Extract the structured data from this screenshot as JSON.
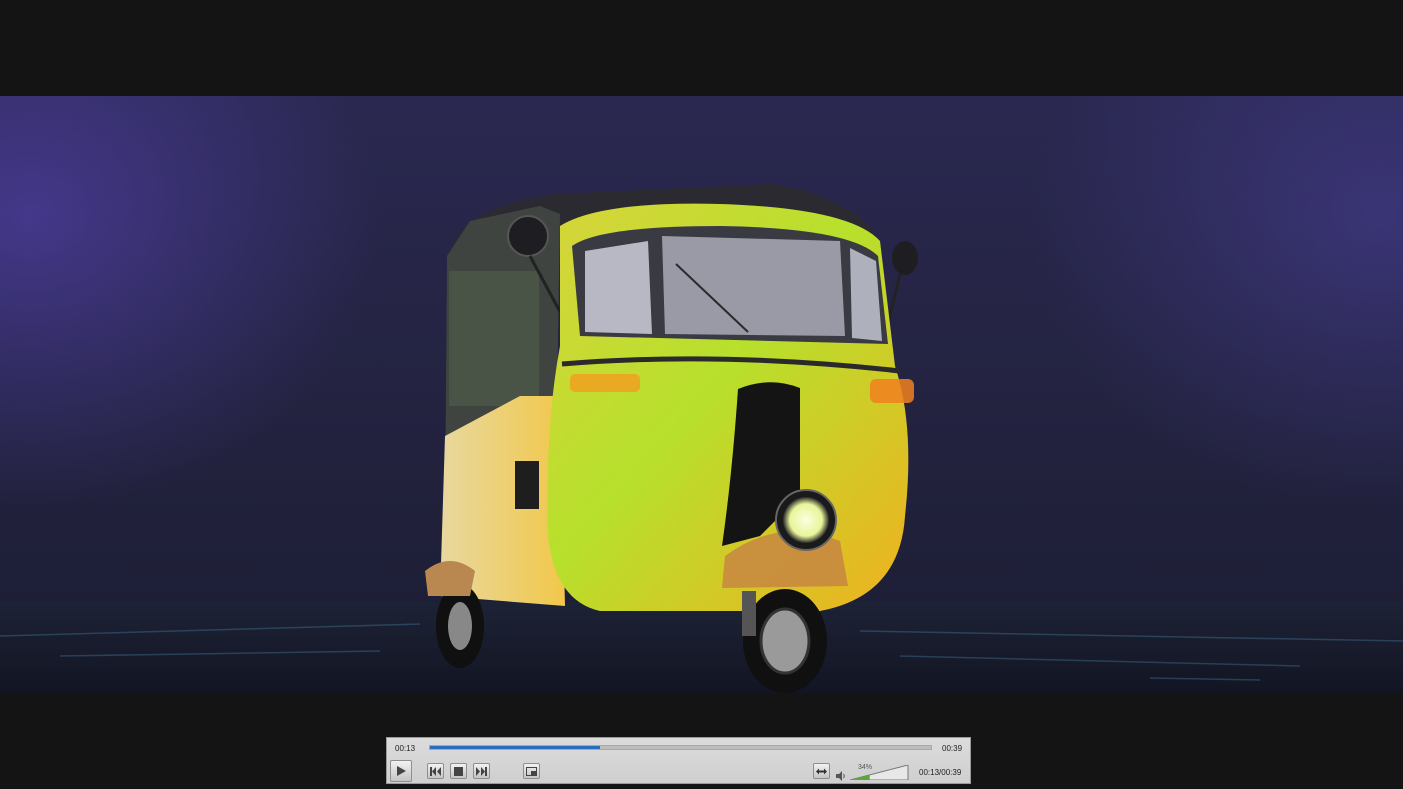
{
  "player": {
    "elapsed": "00:13",
    "duration": "00:39",
    "progress_fraction": 0.34,
    "volume_label": "34%",
    "volume_fraction": 0.34,
    "time_readout": "00:13/00:39"
  },
  "controls": {
    "play": "play-icon",
    "previous": "skip-back-icon",
    "stop": "stop-icon",
    "next": "skip-forward-icon",
    "snapshot": "picture-in-picture-icon",
    "fit": "fit-width-icon",
    "volume": "speaker-icon"
  },
  "colors": {
    "progress": "#2a6fbd",
    "volume": "#59a838",
    "bar_background": "#d4d4d4"
  }
}
